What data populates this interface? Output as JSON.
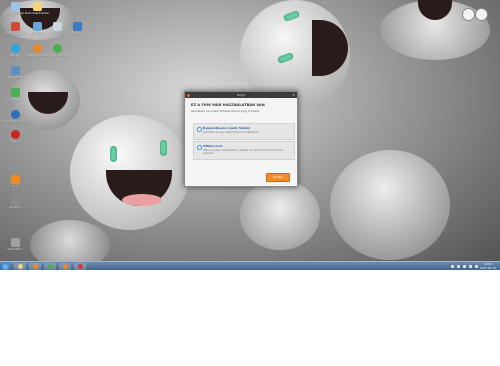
{
  "desktop_icons": [
    {
      "label": "Számítógép"
    },
    {
      "label": "Dokumentumok"
    },
    {
      "label": "Adobe Reader"
    },
    {
      "label": "Hálózat"
    },
    {
      "label": "Lomtár"
    },
    {
      "label": "Outlook"
    },
    {
      "label": "Skype"
    },
    {
      "label": "Mozilla Firefox"
    },
    {
      "label": "Google Chrome"
    },
    {
      "label": "Vezérlőpult"
    },
    {
      "label": "Letöltések"
    },
    {
      "label": "Internet Explorer"
    },
    {
      "label": "Opera"
    },
    {
      "label": "VLC"
    },
    {
      "label": "Winamp"
    },
    {
      "label": "Kalkulátor"
    }
  ],
  "dialog": {
    "title": "Origo",
    "heading": "EZ A FIÓK MÁR HASZNÁLATBAN VAN",
    "subtitle": "Jelentkezz be másik felhasználóval vagy folytasd.",
    "options": [
      {
        "title": "Bejelentkezés másik fiókkal",
        "desc": "Jelentkezz be egy másik fiókkal a folytatáshoz."
      },
      {
        "title": "Offline mód",
        "desc": "Offline módban folytathatod a játékot, de néhány funkció nem lesz elérhető."
      }
    ],
    "ok_label": "Tovább"
  },
  "clock": {
    "time": "12:34",
    "date": "2013.01.10"
  },
  "colors": {
    "taskbar": "#3d5e80",
    "ok_button": "#f08c2a",
    "accent": "#3c8fd1"
  }
}
